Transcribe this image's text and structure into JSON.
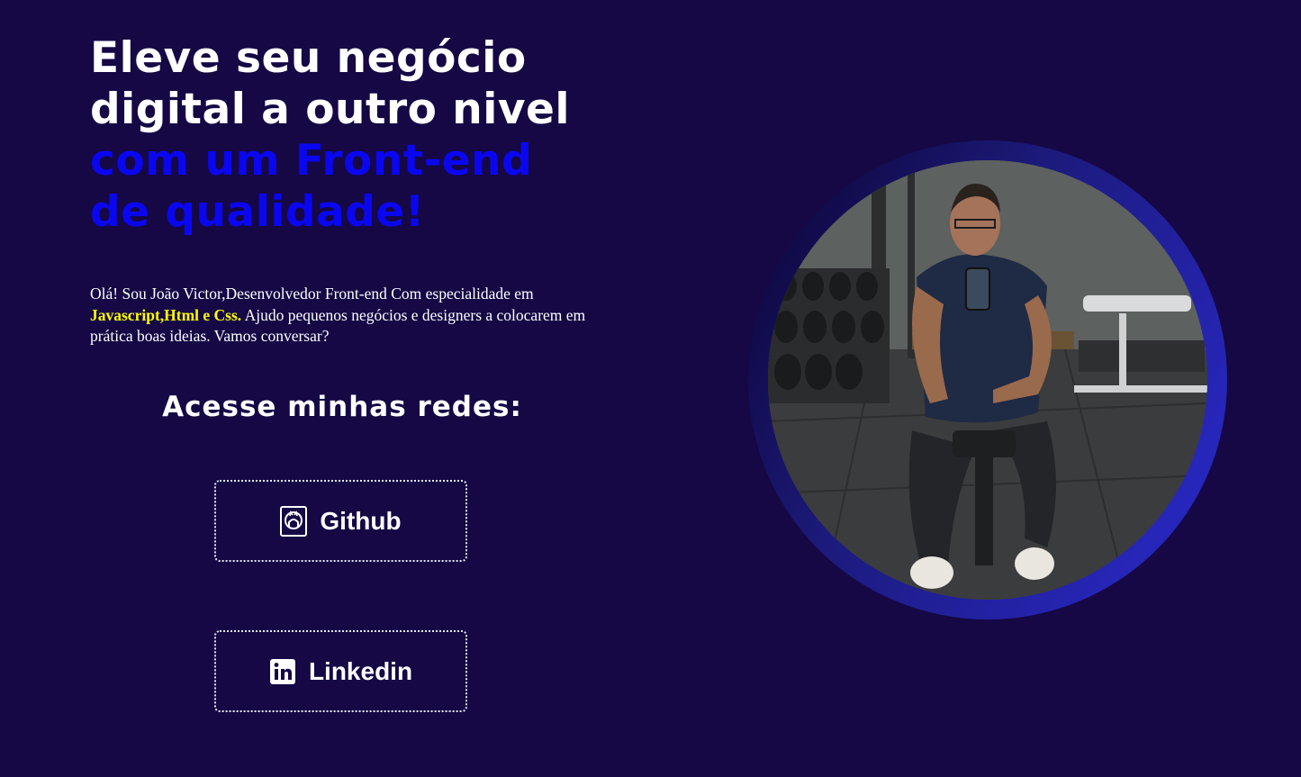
{
  "hero": {
    "headline_line1": "Eleve seu negócio",
    "headline_line2": "digital a outro nivel",
    "headline_line3": "com um Front-end",
    "headline_line4": "de qualidade!",
    "intro_before": "Olá! Sou João Victor,Desenvolvedor Front-end Com especialidade em ",
    "intro_highlight": "Javascript,Html e Css.",
    "intro_after": " Ajudo pequenos negócios e designers a colocarem em prática boas ideias. Vamos conversar?"
  },
  "social": {
    "title": "Acesse minhas redes:",
    "buttons": [
      {
        "label": "Github",
        "icon": "github-icon"
      },
      {
        "label": "Linkedin",
        "icon": "linkedin-icon"
      }
    ]
  },
  "profile_photo": {
    "subject": "man taking a mirror selfie in a gym"
  },
  "colors": {
    "background": "#150845",
    "headline_white": "#ffffff",
    "headline_accent": "#0a06f2",
    "highlight": "#ffff00",
    "ring_accent": "#2a2ad0"
  }
}
